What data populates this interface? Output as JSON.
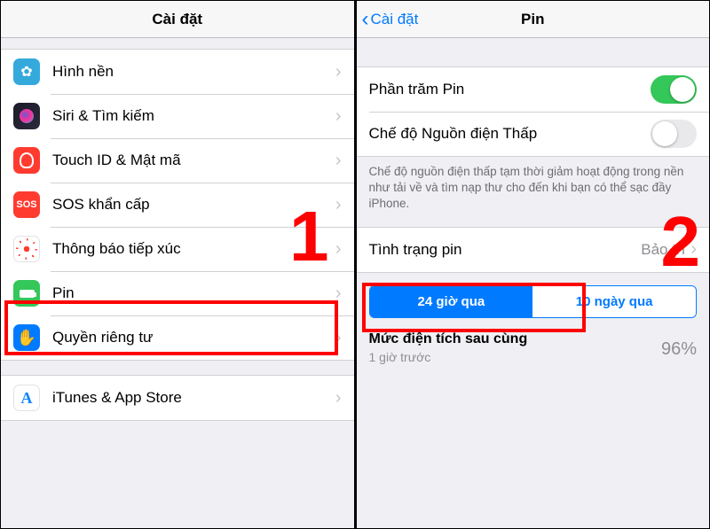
{
  "left": {
    "header_title": "Cài đặt",
    "items": [
      {
        "label": "Hình nền",
        "icon_name": "wallpaper-icon"
      },
      {
        "label": "Siri & Tìm kiếm",
        "icon_name": "siri-icon"
      },
      {
        "label": "Touch ID & Mật mã",
        "icon_name": "touchid-icon"
      },
      {
        "label": "SOS khẩn cấp",
        "icon_name": "sos-icon"
      },
      {
        "label": "Thông báo tiếp xúc",
        "icon_name": "exposure-icon"
      },
      {
        "label": "Pin",
        "icon_name": "battery-icon"
      },
      {
        "label": "Quyền riêng tư",
        "icon_name": "privacy-icon"
      }
    ],
    "items2": [
      {
        "label": "iTunes & App Store",
        "icon_name": "appstore-icon"
      }
    ]
  },
  "right": {
    "back_label": "Cài đặt",
    "header_title": "Pin",
    "toggle_percent_label": "Phần trăm Pin",
    "toggle_percent_on": true,
    "toggle_lowpower_label": "Chế độ Nguồn điện Thấp",
    "toggle_lowpower_on": false,
    "lowpower_desc": "Chế độ nguồn điện thấp tạm thời giảm hoạt động trong nền như tải về và tìm nạp thư cho đến khi bạn có thể sạc đầy iPhone.",
    "battery_health_label": "Tình trạng pin",
    "battery_health_value": "Bảo trì",
    "seg_left": "24 giờ qua",
    "seg_right": "10 ngày qua",
    "last_charge_title": "Mức điện tích sau cùng",
    "last_charge_sub": "1 giờ trước",
    "last_charge_value": "96%"
  },
  "annotations": {
    "label_left": "1",
    "label_right": "2"
  }
}
